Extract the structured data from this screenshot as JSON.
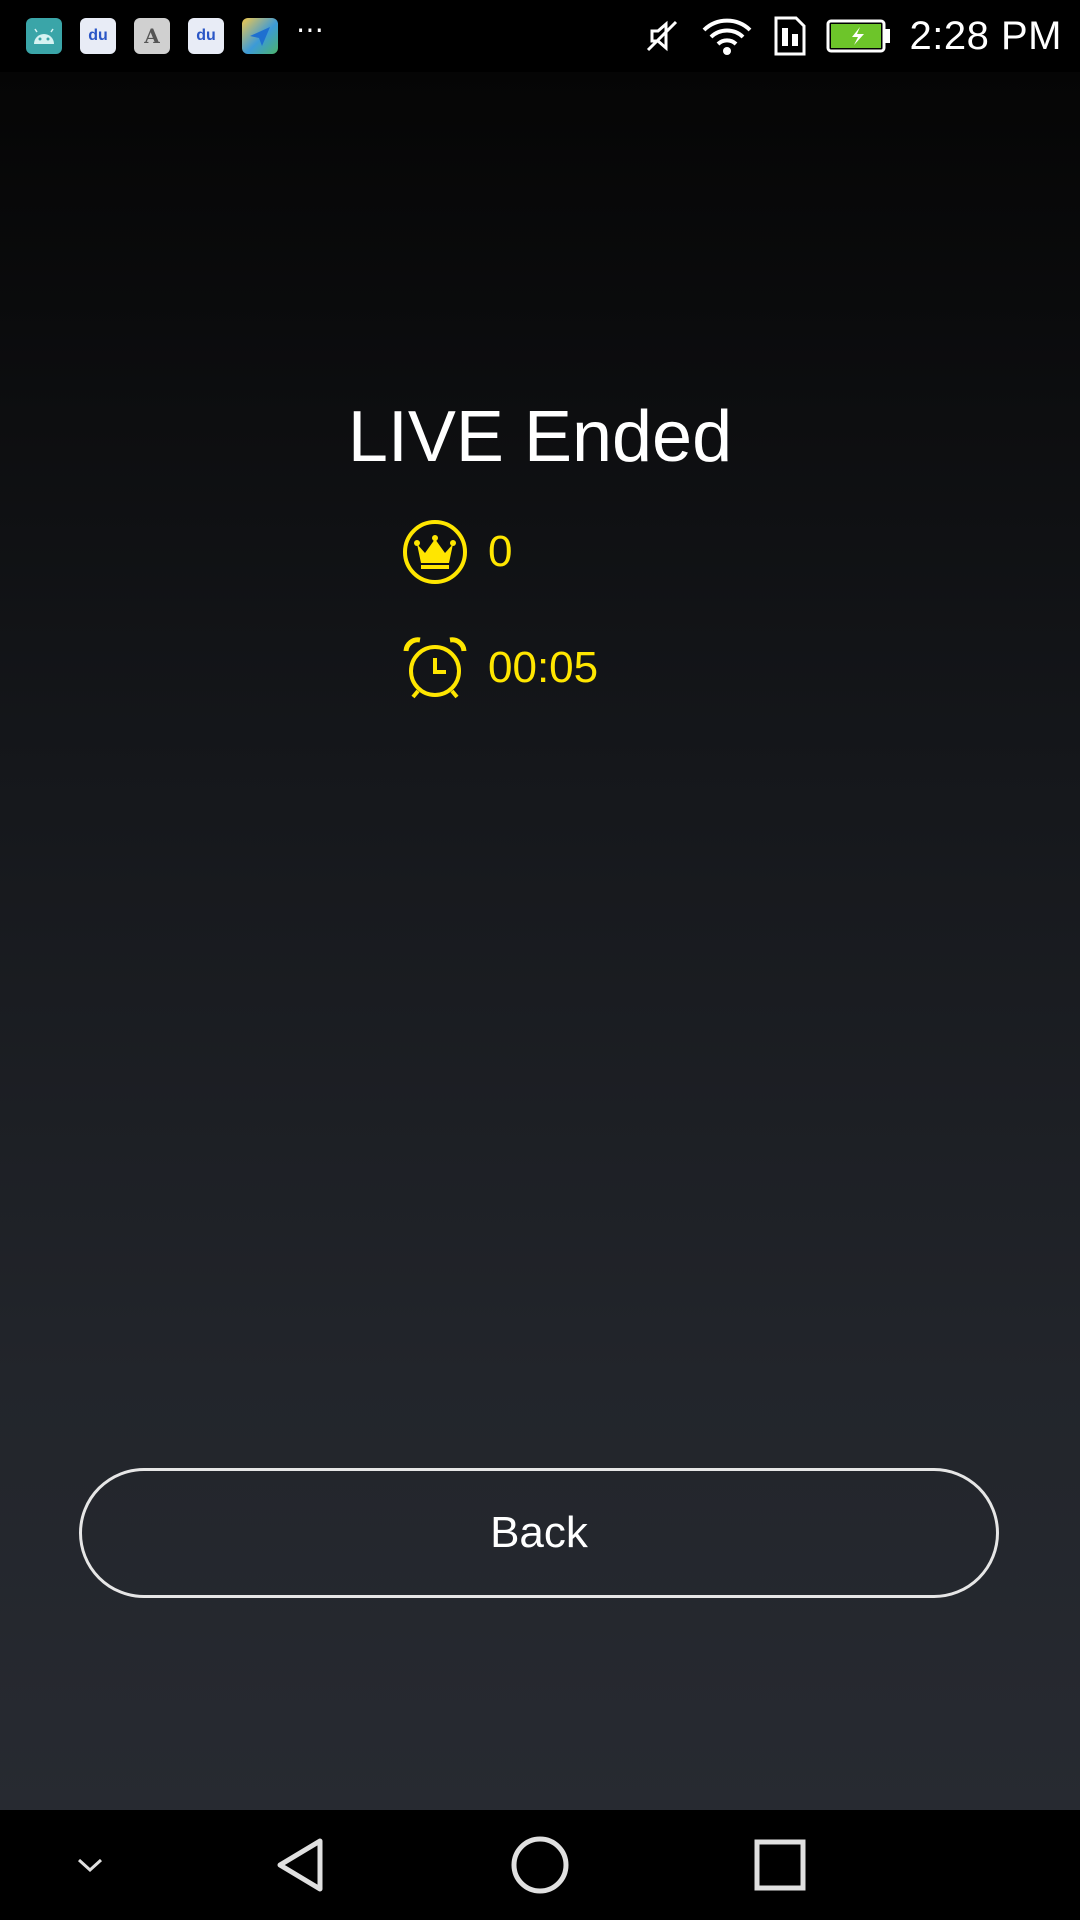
{
  "status_bar": {
    "time": "2:28 PM",
    "notification_icons": [
      "android-icon",
      "baidu-icon",
      "font-a-icon",
      "baidu-icon",
      "map-send-icon"
    ],
    "more_label": "⋯",
    "a_glyph": "A",
    "baidu_glyph": "du"
  },
  "main": {
    "title": "LIVE Ended",
    "stats": {
      "crown_count": "0",
      "duration": "00:05"
    },
    "back_label": "Back"
  },
  "colors": {
    "accent": "#ffe600",
    "battery_fill": "#6dc52a"
  }
}
